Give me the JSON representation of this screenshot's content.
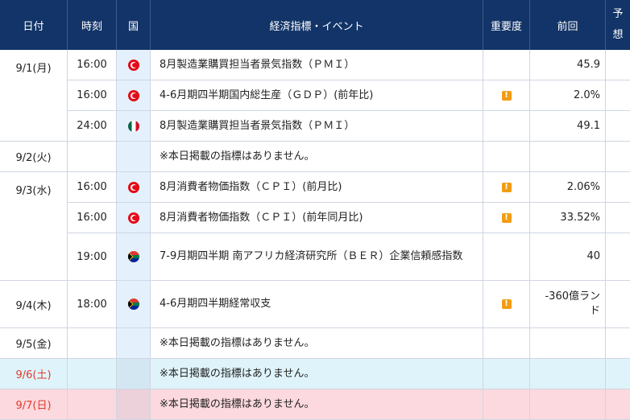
{
  "header": {
    "date": "日付",
    "time": "時刻",
    "country": "国",
    "event": "経済指標・イベント",
    "importance": "重要度",
    "previous": "前回",
    "forecast_1": "予",
    "forecast_2": "想"
  },
  "colors": {
    "header_bg": "#123468",
    "importance_icon": "#f39c12",
    "saturday_bg": "#dff4fa",
    "sunday_bg": "#fcd9de"
  },
  "rows": [
    {
      "date": "9/1(月)",
      "time": "16:00",
      "country": "turkey-flag-icon",
      "event": "8月製造業購買担当者景気指数（ＰＭＩ）",
      "important": false,
      "previous": "45.9"
    },
    {
      "date": "",
      "time": "16:00",
      "country": "turkey-flag-icon",
      "event": "4-6月期四半期国内総生産（ＧＤＰ）(前年比)",
      "important": true,
      "previous": "2.0%"
    },
    {
      "date": "",
      "time": "24:00",
      "country": "mexico-flag-icon",
      "event": "8月製造業購買担当者景気指数（ＰＭＩ）",
      "important": false,
      "previous": "49.1"
    },
    {
      "date": "9/2(火)",
      "time": "",
      "country": "",
      "event": "※本日掲載の指標はありません。",
      "important": false,
      "previous": ""
    },
    {
      "date": "9/3(水)",
      "time": "16:00",
      "country": "turkey-flag-icon",
      "event": "8月消費者物価指数（ＣＰＩ）(前月比)",
      "important": true,
      "previous": "2.06%"
    },
    {
      "date": "",
      "time": "16:00",
      "country": "turkey-flag-icon",
      "event": "8月消費者物価指数（ＣＰＩ）(前年同月比)",
      "important": true,
      "previous": "33.52%"
    },
    {
      "date": "",
      "time": "19:00",
      "country": "south-africa-flag-icon",
      "event": "7-9月期四半期 南アフリカ経済研究所（ＢＥＲ）企業信頼感指数",
      "important": false,
      "previous": "40"
    },
    {
      "date": "9/4(木)",
      "time": "18:00",
      "country": "south-africa-flag-icon",
      "event": "4-6月期四半期経常収支",
      "important": true,
      "previous": "-360億ランド"
    },
    {
      "date": "9/5(金)",
      "time": "",
      "country": "",
      "event": "※本日掲載の指標はありません。",
      "important": false,
      "previous": ""
    },
    {
      "date": "9/6(土)",
      "time": "",
      "country": "",
      "event": "※本日掲載の指標はありません。",
      "important": false,
      "previous": ""
    },
    {
      "date": "9/7(日)",
      "time": "",
      "country": "",
      "event": "※本日掲載の指標はありません。",
      "important": false,
      "previous": ""
    }
  ],
  "importance_icon": "!"
}
